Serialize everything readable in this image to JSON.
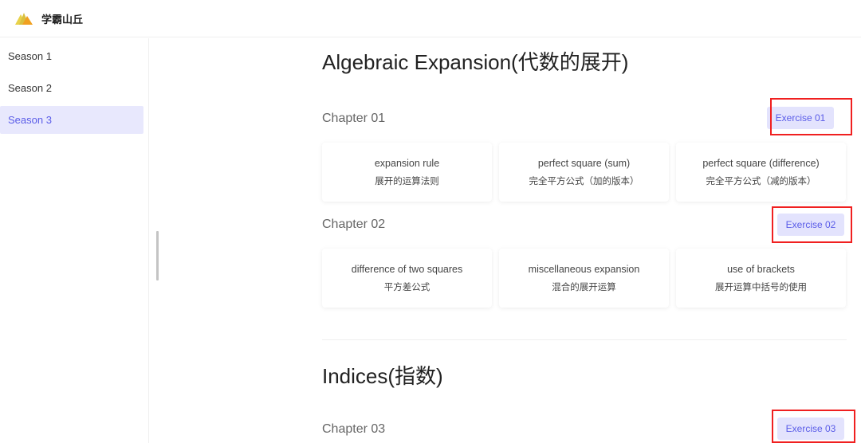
{
  "app": {
    "title": "学霸山丘",
    "logo_icon": "mountain-logo-icon"
  },
  "sidebar": {
    "items": [
      {
        "label": "Season 1",
        "active": false
      },
      {
        "label": "Season 2",
        "active": false
      },
      {
        "label": "Season 3",
        "active": true
      }
    ]
  },
  "sections": [
    {
      "title": "Algebraic Expansion(代数的展开)",
      "chapters": [
        {
          "title": "Chapter 01",
          "exercise_label": "Exercise 01",
          "topics": [
            {
              "en": "expansion rule",
              "zh": "展开的运算法则"
            },
            {
              "en": "perfect square (sum)",
              "zh": "完全平方公式（加的版本）"
            },
            {
              "en": "perfect square (difference)",
              "zh": "完全平方公式（减的版本）"
            }
          ]
        },
        {
          "title": "Chapter 02",
          "exercise_label": "Exercise 02",
          "topics": [
            {
              "en": "difference of two squares",
              "zh": "平方差公式"
            },
            {
              "en": "miscellaneous expansion",
              "zh": "混合的展开运算"
            },
            {
              "en": "use of brackets",
              "zh": "展开运算中括号的使用"
            }
          ]
        }
      ]
    },
    {
      "title": "Indices(指数)",
      "chapters": [
        {
          "title": "Chapter 03",
          "exercise_label": "Exercise 03"
        }
      ]
    }
  ],
  "colors": {
    "accent": "#5a5ce8",
    "accent_bg": "#e3e3fd",
    "highlight": "#f02020"
  }
}
